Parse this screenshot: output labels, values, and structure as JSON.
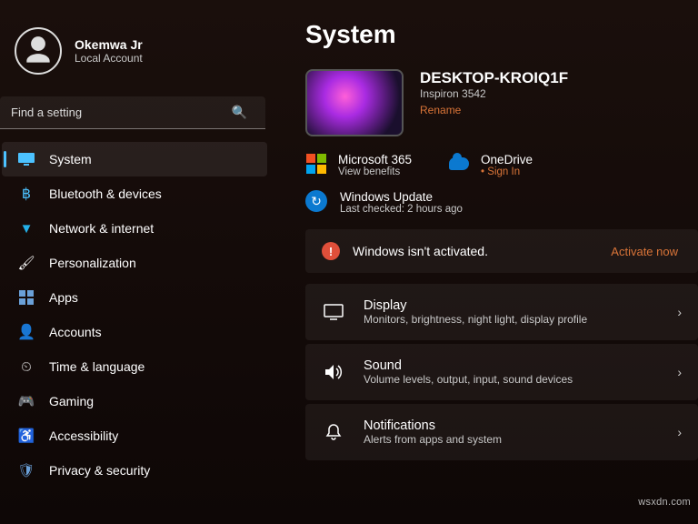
{
  "user": {
    "name": "Okemwa Jr",
    "sub": "Local Account"
  },
  "search": {
    "placeholder": "Find a setting"
  },
  "nav": [
    {
      "label": "System",
      "icon": "system",
      "selected": true
    },
    {
      "label": "Bluetooth & devices",
      "icon": "bluetooth"
    },
    {
      "label": "Network & internet",
      "icon": "network"
    },
    {
      "label": "Personalization",
      "icon": "personalization"
    },
    {
      "label": "Apps",
      "icon": "apps"
    },
    {
      "label": "Accounts",
      "icon": "accounts"
    },
    {
      "label": "Time & language",
      "icon": "time"
    },
    {
      "label": "Gaming",
      "icon": "gaming"
    },
    {
      "label": "Accessibility",
      "icon": "accessibility"
    },
    {
      "label": "Privacy & security",
      "icon": "privacy"
    }
  ],
  "page": {
    "title": "System"
  },
  "device": {
    "name": "DESKTOP-KROIQ1F",
    "model": "Inspiron 3542",
    "rename": "Rename"
  },
  "ms365": {
    "title": "Microsoft 365",
    "sub": "View benefits"
  },
  "onedrive": {
    "title": "OneDrive",
    "sub": "Sign In"
  },
  "update": {
    "title": "Windows Update",
    "sub": "Last checked: 2 hours ago"
  },
  "activation": {
    "msg": "Windows isn't activated.",
    "action": "Activate now"
  },
  "panels": [
    {
      "title": "Display",
      "sub": "Monitors, brightness, night light, display profile",
      "icon": "display"
    },
    {
      "title": "Sound",
      "sub": "Volume levels, output, input, sound devices",
      "icon": "sound"
    },
    {
      "title": "Notifications",
      "sub": "Alerts from apps and system",
      "icon": "notifications"
    }
  ],
  "watermark": "wsxdn.com"
}
